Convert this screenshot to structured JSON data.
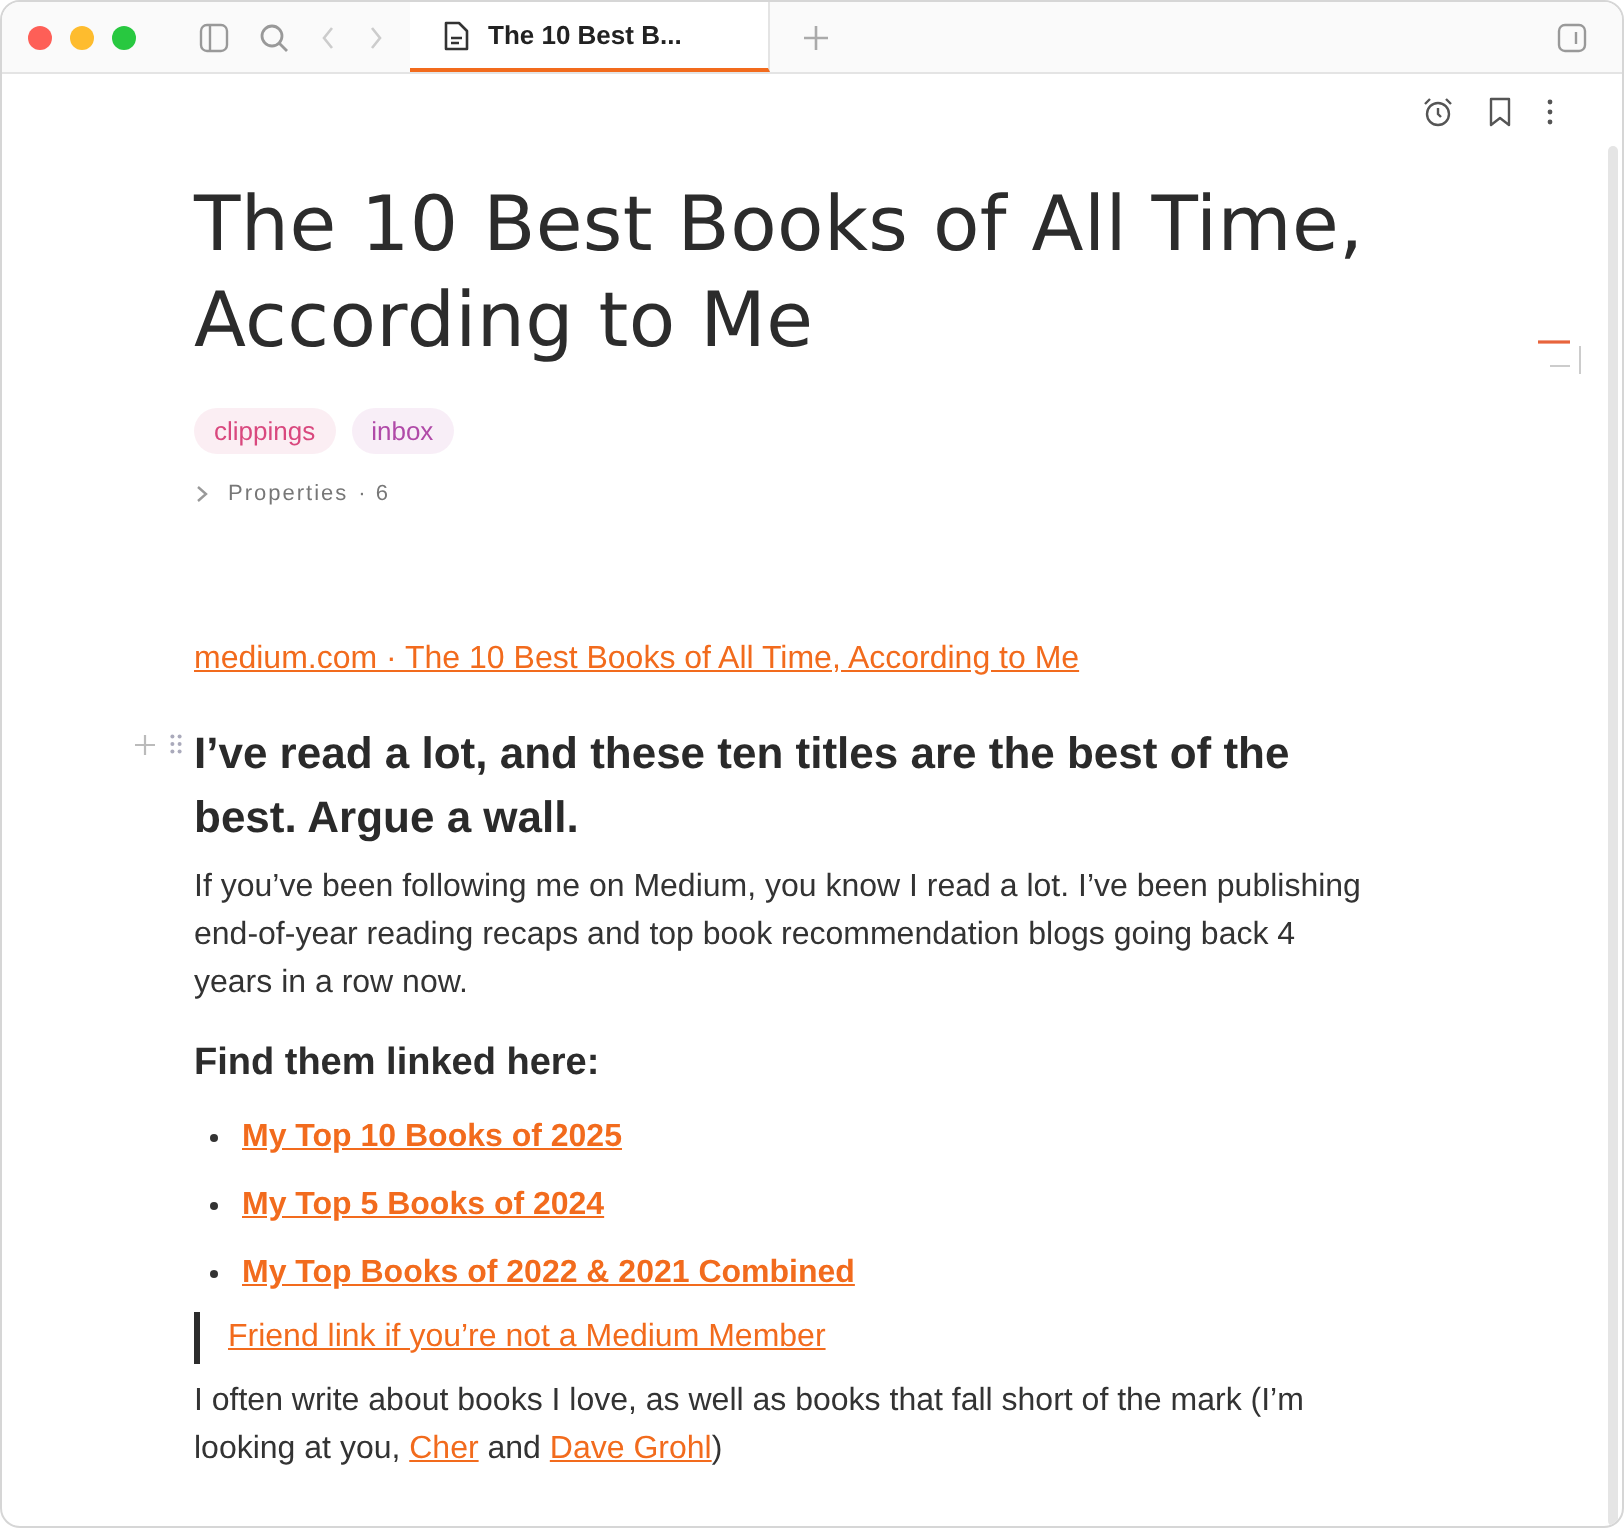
{
  "tab": {
    "title": "The 10 Best B...",
    "selected": true
  },
  "note": {
    "title": "The 10 Best Books of All Time, According to Me",
    "tags": [
      {
        "label": "clippings",
        "color": "#d9487e"
      },
      {
        "label": "inbox",
        "color": "#b04aa8"
      }
    ],
    "properties": {
      "label": "Properties",
      "count": "· 6",
      "expanded": false
    },
    "source_link": "medium.com · The 10 Best Books of All Time, According to Me",
    "heading": "I’ve read a lot, and these ten titles are the best of the best. Argue a wall.",
    "intro": "If you’ve been following me on Medium, you know I read a lot. I’ve been publishing end-of-year reading recaps and top book recommendation blogs going back 4 years in a row now.",
    "subheading": "Find them linked here:",
    "links": [
      "My Top 10 Books of 2025",
      "My Top 5 Books of 2024",
      "My Top Books of 2022 & 2021 Combined"
    ],
    "quote_link": "Friend link if you’re not a Medium Member",
    "closing": [
      {
        "kind": "text",
        "text": "I often write about books I love, as well as books that fall short of the mark (I’m looking at you, "
      },
      {
        "kind": "link",
        "text": "Cher"
      },
      {
        "kind": "text",
        "text": " and "
      },
      {
        "kind": "link",
        "text": "Dave Grohl"
      },
      {
        "kind": "text",
        "text": ")"
      }
    ]
  }
}
